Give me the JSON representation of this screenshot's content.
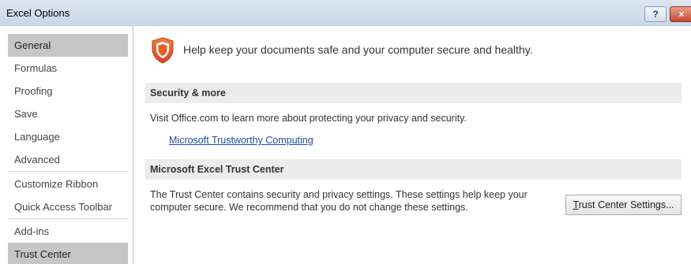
{
  "window": {
    "title": "Excel Options",
    "help_label": "?",
    "close_label": "×"
  },
  "sidebar": {
    "items": [
      {
        "label": "General",
        "selected": true
      },
      {
        "label": "Formulas",
        "selected": false
      },
      {
        "label": "Proofing",
        "selected": false
      },
      {
        "label": "Save",
        "selected": false
      },
      {
        "label": "Language",
        "selected": false
      },
      {
        "label": "Advanced",
        "selected": false
      },
      {
        "label": "Customize Ribbon",
        "selected": false
      },
      {
        "label": "Quick Access Toolbar",
        "selected": false
      },
      {
        "label": "Add-ins",
        "selected": false
      },
      {
        "label": "Trust Center",
        "selected": true
      }
    ]
  },
  "main": {
    "intro_text": "Help keep your documents safe and your computer secure and healthy.",
    "shield_icon": "shield-icon",
    "shield_color": "#e8511f",
    "security_section": {
      "header": "Security & more",
      "text": "Visit Office.com to learn more about protecting your privacy and security.",
      "link": "Microsoft Trustworthy Computing"
    },
    "trust_center_section": {
      "header": "Microsoft Excel Trust Center",
      "text_line1": "The Trust Center contains security and privacy settings. These settings help keep your",
      "text_line2": "computer secure. We recommend that you do not change these settings.",
      "button_accesskey": "T",
      "button_rest": "rust Center Settings..."
    }
  }
}
